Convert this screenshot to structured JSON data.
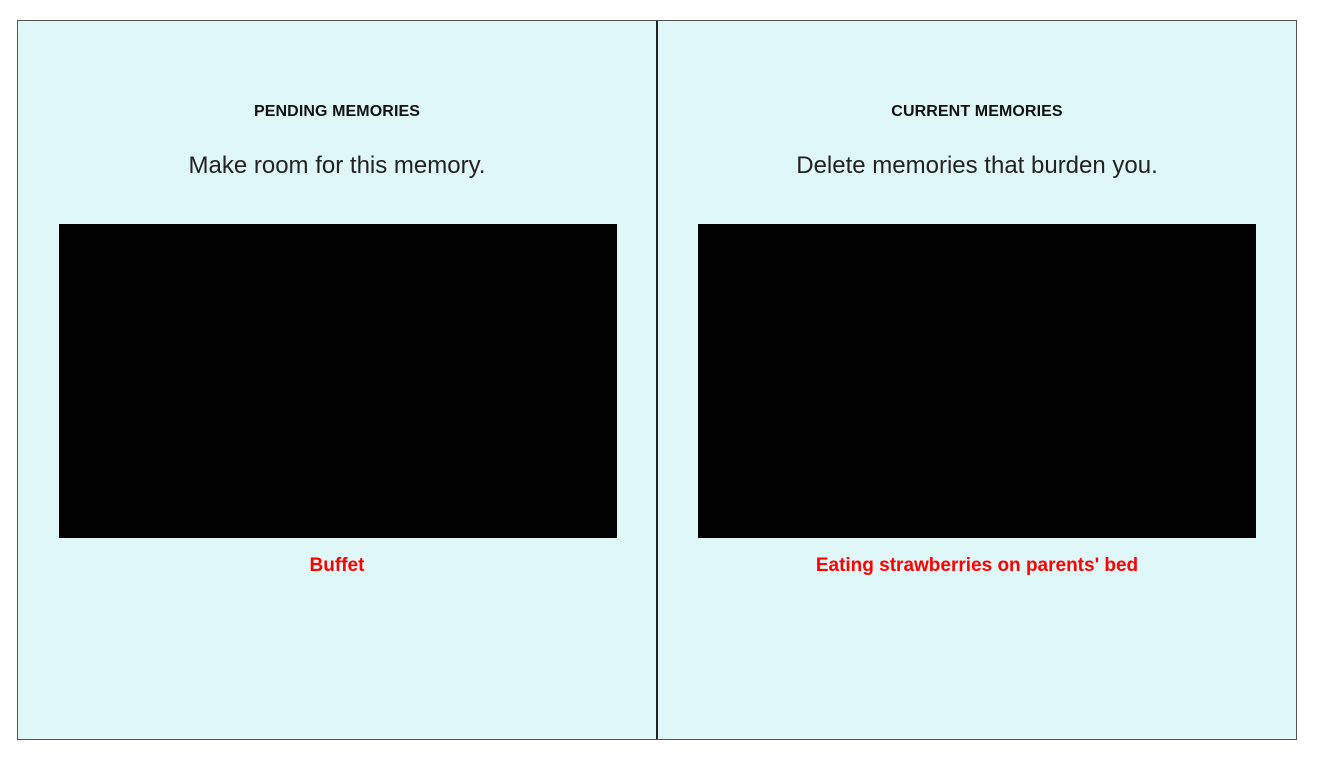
{
  "pending": {
    "heading": "PENDING MEMORIES",
    "instruction": "Make room for this memory.",
    "caption": "Buffet"
  },
  "current": {
    "heading": "CURRENT MEMORIES",
    "instruction": "Delete memories that burden you.",
    "caption": "Eating strawberries on parents' bed"
  },
  "colors": {
    "background": "#e0f7f8",
    "caption": "#ff0000",
    "image": "#000000"
  }
}
